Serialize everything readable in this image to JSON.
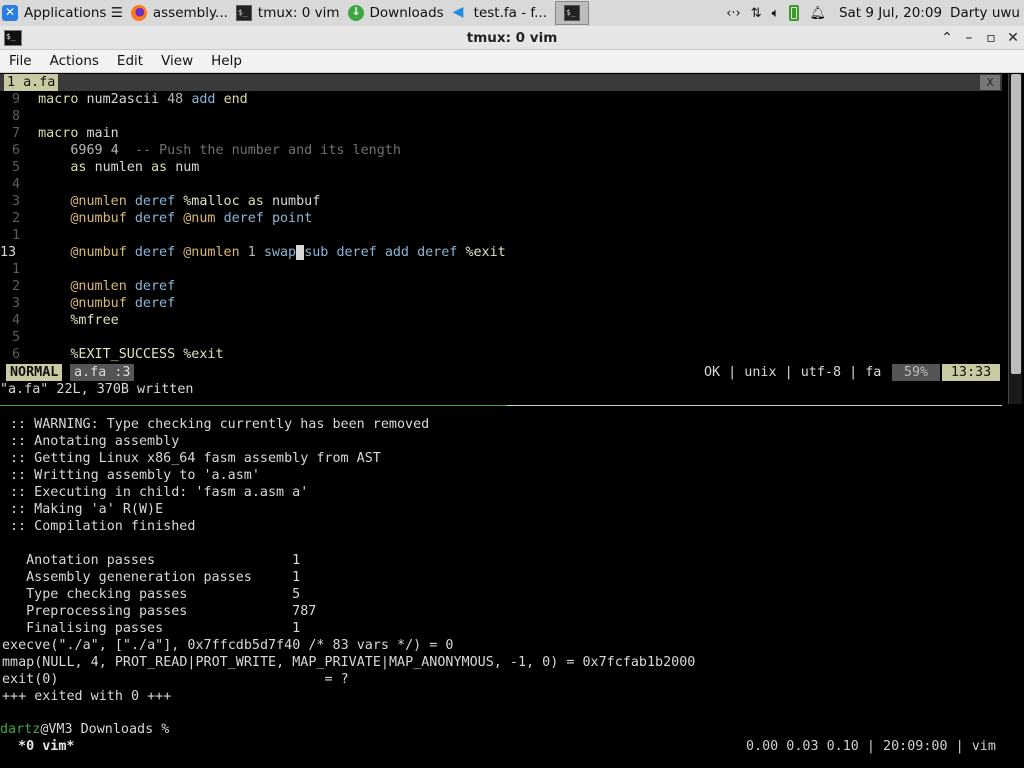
{
  "panel": {
    "tasks": [
      {
        "label": "Applications ☰"
      },
      {
        "label": "assembly..."
      },
      {
        "label": "tmux: 0 vim"
      },
      {
        "label": "Downloads"
      },
      {
        "label": "test.fa - f..."
      }
    ],
    "clock": "Sat  9 Jul, 20:09",
    "user": "Darty uwu"
  },
  "window": {
    "title": "tmux: 0 vim"
  },
  "menu": [
    "File",
    "Actions",
    "Edit",
    "View",
    "Help"
  ],
  "vim": {
    "tab_label": "1 a.fa",
    "tab_close": "X",
    "lines": [
      {
        "ln": "9",
        "text": "macro num2ascii 48 add end"
      },
      {
        "ln": "8",
        "text": ""
      },
      {
        "ln": "7",
        "text": "macro main"
      },
      {
        "ln": "6",
        "text": "    6969 4  -- Push the number and its length"
      },
      {
        "ln": "5",
        "text": "    as numlen as num"
      },
      {
        "ln": "4",
        "text": ""
      },
      {
        "ln": "3",
        "text": "    @numlen deref %malloc as numbuf"
      },
      {
        "ln": "2",
        "text": "    @numbuf deref @num deref point"
      },
      {
        "ln": "1",
        "text": ""
      },
      {
        "ln": "13",
        "text": "    @numbuf deref @numlen 1 swap sub deref add deref %exit"
      },
      {
        "ln": "1",
        "text": ""
      },
      {
        "ln": "2",
        "text": "    @numlen deref"
      },
      {
        "ln": "3",
        "text": "    @numbuf deref"
      },
      {
        "ln": "4",
        "text": "    %mfree"
      },
      {
        "ln": "5",
        "text": ""
      },
      {
        "ln": "6",
        "text": "    %EXIT_SUCCESS %exit"
      }
    ],
    "mode": "NORMAL",
    "file": "a.fa",
    "col": ":3",
    "info": "OK | unix | utf-8 | fa",
    "percent": "59%",
    "position": "13:33",
    "message": "\"a.fa\" 22L, 370B written"
  },
  "shell": {
    "log": [
      ":: WARNING: Type checking currently has been removed",
      ":: Anotating assembly",
      ":: Getting Linux x86_64 fasm assembly from AST",
      ":: Writting assembly to 'a.asm'",
      ":: Executing in child: 'fasm a.asm a'",
      ":: Making 'a' R(W)E",
      ":: Compilation finished",
      "",
      "  Anotation passes                 1",
      "  Assembly geneneration passes     1",
      "  Type checking passes             5",
      "  Preprocessing passes             787",
      "  Finalising passes                1"
    ],
    "strace": [
      "execve(\"./a\", [\"./a\"], 0x7ffcdb5d7f40 /* 83 vars */) = 0",
      "mmap(NULL, 4, PROT_READ|PROT_WRITE, MAP_PRIVATE|MAP_ANONYMOUS, -1, 0) = 0x7fcfab1b2000",
      "exit(0)                                 = ?",
      "+++ exited with 0 +++"
    ],
    "prompt_user": "dartz",
    "prompt_rest": "@VM3 Downloads %"
  },
  "tmux": {
    "window": " *0 vim*",
    "right": "0.00 0.03 0.10 | 20:09:00 | vim"
  }
}
